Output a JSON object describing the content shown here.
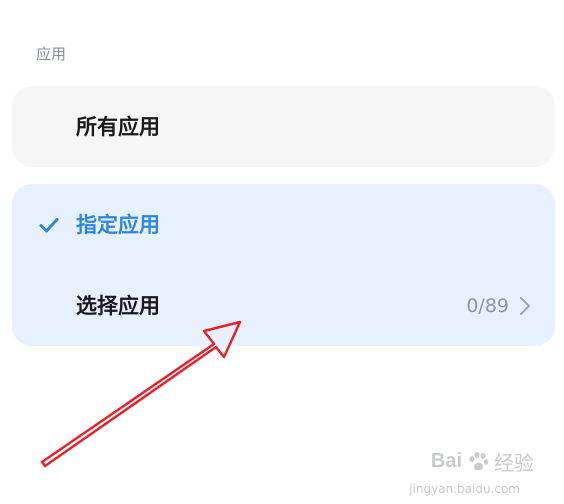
{
  "section": {
    "label": "应用"
  },
  "options": {
    "all_apps": {
      "label": "所有应用",
      "selected": false
    },
    "specified_apps": {
      "label": "指定应用",
      "selected": true
    },
    "choose_apps": {
      "label": "选择应用",
      "count": "0/89"
    }
  },
  "icons": {
    "check": "check-icon",
    "chevron": "chevron-right-icon"
  },
  "colors": {
    "accent": "#2d85e6",
    "selected_card_bg": "#e7f1fd",
    "card_bg": "#f6f6f6",
    "annotation_arrow": "#e8202a"
  },
  "watermark": {
    "brand": "Bai",
    "suffix": "经验",
    "url": "jingyan.baidu.com"
  }
}
